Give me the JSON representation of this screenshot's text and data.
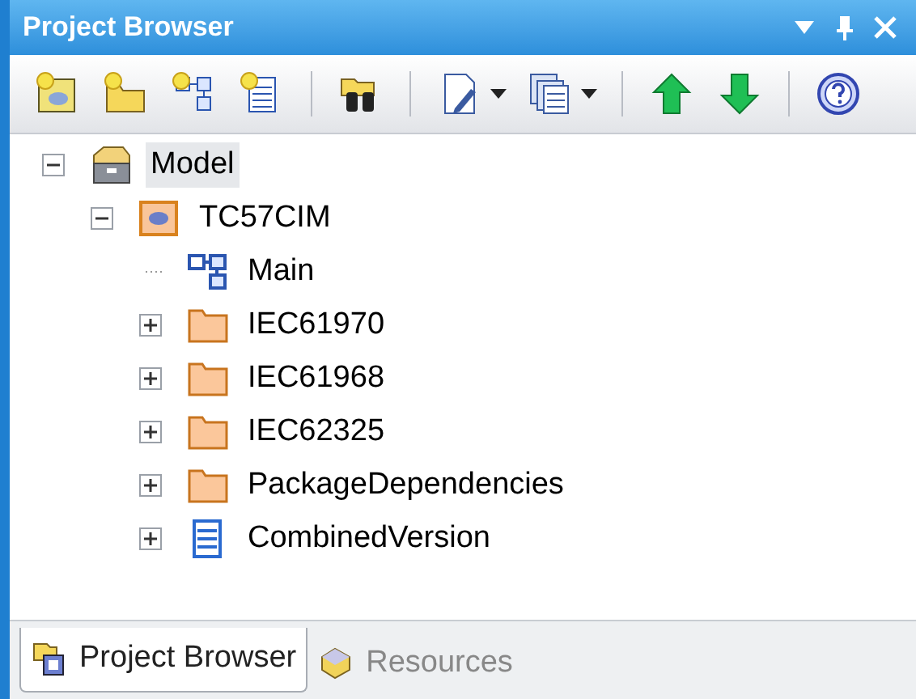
{
  "window": {
    "title": "Project Browser"
  },
  "title_buttons": [
    {
      "kind": "dropdown"
    },
    {
      "kind": "pin"
    },
    {
      "kind": "close"
    }
  ],
  "toolbar": [
    {
      "kind": "new-model",
      "dropdown": false
    },
    {
      "kind": "new-package",
      "dropdown": false
    },
    {
      "kind": "new-diagram",
      "dropdown": false
    },
    {
      "kind": "new-element",
      "dropdown": false
    },
    {
      "kind": "separator"
    },
    {
      "kind": "find",
      "dropdown": false
    },
    {
      "kind": "separator"
    },
    {
      "kind": "edit",
      "dropdown": true
    },
    {
      "kind": "documents",
      "dropdown": true
    },
    {
      "kind": "separator"
    },
    {
      "kind": "move-up",
      "dropdown": false
    },
    {
      "kind": "move-down",
      "dropdown": false
    },
    {
      "kind": "separator"
    },
    {
      "kind": "help",
      "dropdown": false
    }
  ],
  "tree": [
    {
      "label": "Model",
      "kind": "model",
      "expanded": true,
      "selected": true,
      "children": [
        {
          "label": "TC57CIM",
          "kind": "package",
          "expanded": true,
          "selected": false,
          "children": [
            {
              "label": "Main",
              "kind": "diagram",
              "selected": false
            },
            {
              "label": "IEC61970",
              "kind": "folder",
              "expanded": false,
              "selected": false
            },
            {
              "label": "IEC61968",
              "kind": "folder",
              "expanded": false,
              "selected": false
            },
            {
              "label": "IEC62325",
              "kind": "folder",
              "expanded": false,
              "selected": false
            },
            {
              "label": "PackageDependencies",
              "kind": "folder",
              "expanded": false,
              "selected": false
            },
            {
              "label": "CombinedVersion",
              "kind": "class",
              "expanded": false,
              "selected": false
            }
          ]
        }
      ]
    }
  ],
  "tabs": [
    {
      "label": "Project Browser",
      "kind": "project",
      "selected": true
    },
    {
      "label": "Resources",
      "kind": "resources",
      "selected": false
    }
  ]
}
